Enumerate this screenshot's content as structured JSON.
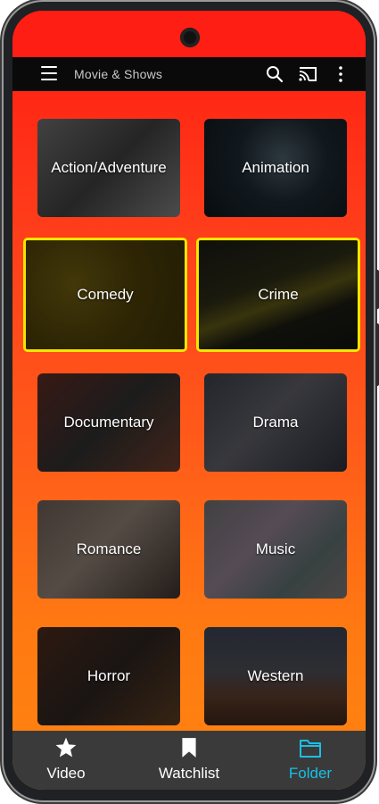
{
  "appbar": {
    "title": "Movie & Shows"
  },
  "categories": [
    {
      "label": "Action/Adventure",
      "selected": false
    },
    {
      "label": "Animation",
      "selected": false
    },
    {
      "label": "Comedy",
      "selected": true
    },
    {
      "label": "Crime",
      "selected": true
    },
    {
      "label": "Documentary",
      "selected": false
    },
    {
      "label": "Drama",
      "selected": false
    },
    {
      "label": "Romance",
      "selected": false
    },
    {
      "label": "Music",
      "selected": false
    },
    {
      "label": "Horror",
      "selected": false
    },
    {
      "label": "Western",
      "selected": false
    }
  ],
  "bottom_nav": {
    "items": [
      {
        "label": "Video",
        "icon": "star-icon",
        "active": false
      },
      {
        "label": "Watchlist",
        "icon": "bookmark-icon",
        "active": false
      },
      {
        "label": "Folder",
        "icon": "folder-icon",
        "active": true
      }
    ]
  },
  "colors": {
    "selected_border": "#f5e600",
    "active_nav": "#19c0e6",
    "header_red": "#ff1e14",
    "footer_orange": "#ff8410"
  }
}
